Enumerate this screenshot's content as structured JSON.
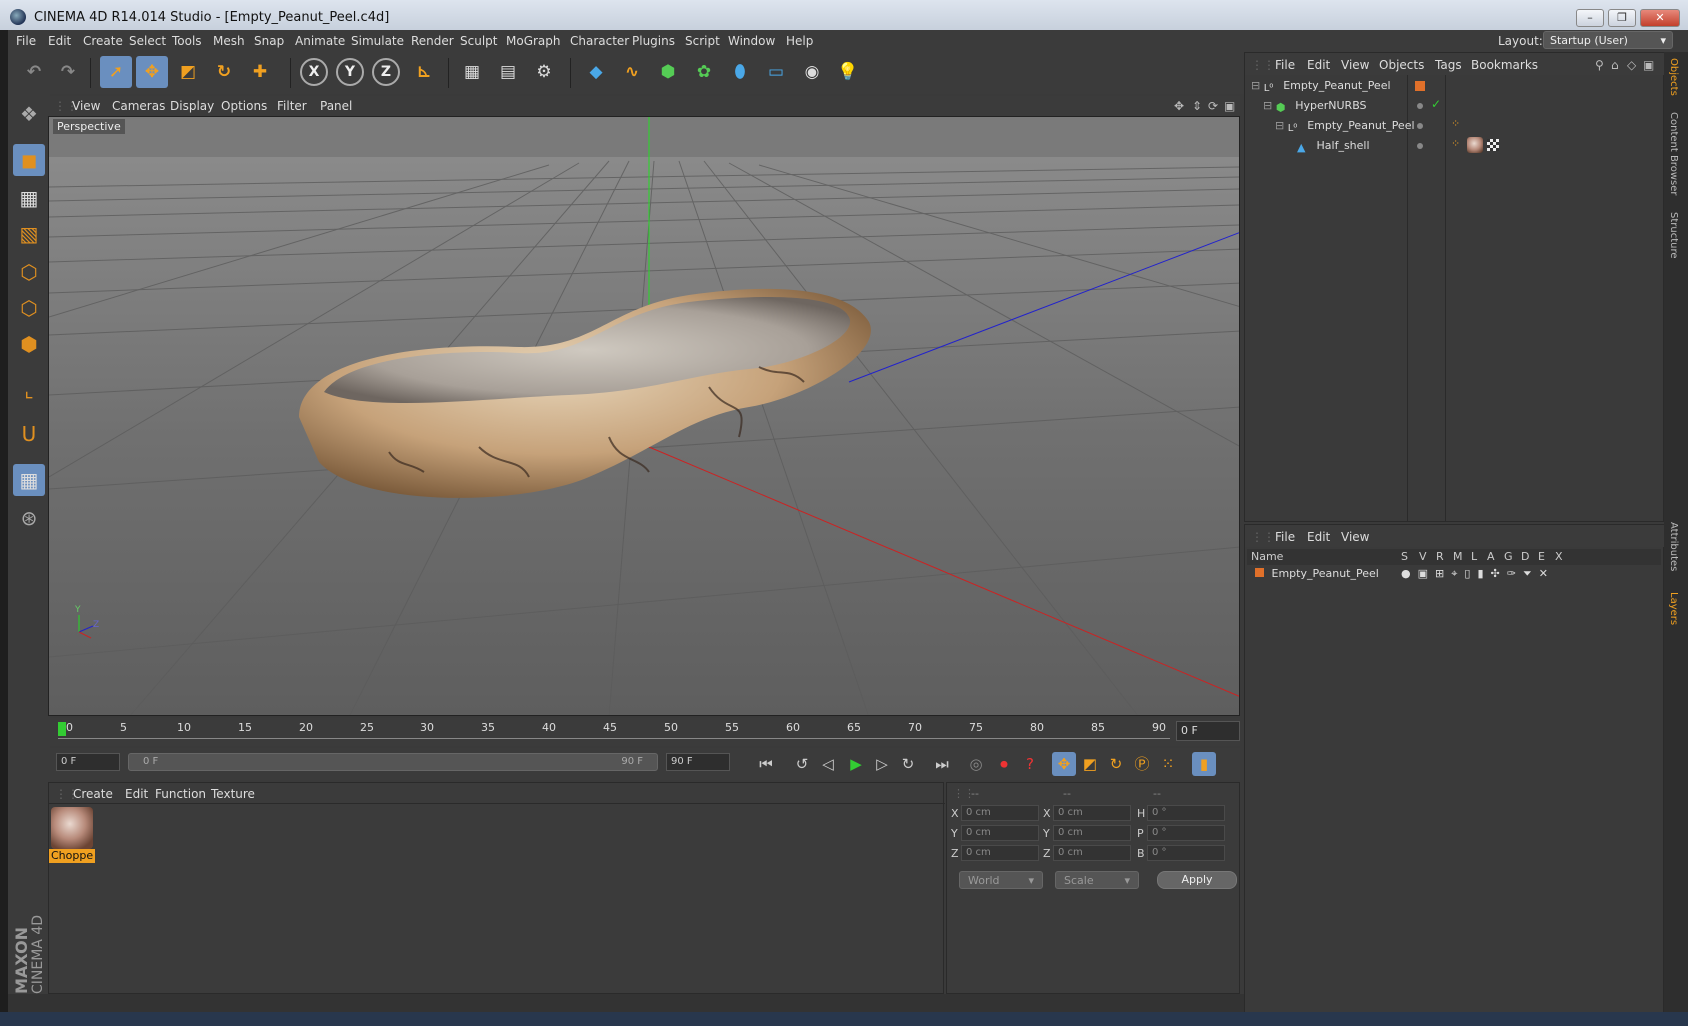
{
  "window": {
    "title": "CINEMA 4D R14.014 Studio - [Empty_Peanut_Peel.c4d]",
    "buttons": [
      "–",
      "❐",
      "✕"
    ]
  },
  "menubar": {
    "items": [
      "File",
      "Edit",
      "Create",
      "Select",
      "Tools",
      "Mesh",
      "Snap",
      "Animate",
      "Simulate",
      "Render",
      "Sculpt",
      "MoGraph",
      "Character",
      "Plugins",
      "Script",
      "Window",
      "Help"
    ],
    "layout_label": "Layout:",
    "layout_value": "Startup (User)"
  },
  "toolbar": {
    "axis_x": "X",
    "axis_y": "Y",
    "axis_z": "Z"
  },
  "viewport": {
    "menu": [
      "View",
      "Cameras",
      "Display",
      "Options",
      "Filter",
      "Panel"
    ],
    "label": "Perspective",
    "axis_y": "Y",
    "axis_z": "Z"
  },
  "timeline": {
    "ticks": [
      "0",
      "5",
      "10",
      "15",
      "20",
      "25",
      "30",
      "35",
      "40",
      "45",
      "50",
      "55",
      "60",
      "65",
      "70",
      "75",
      "80",
      "85",
      "90"
    ],
    "current_frame": "0 F"
  },
  "transport": {
    "start_field": "0 F",
    "range_start": "0 F",
    "range_end": "90 F",
    "end_field": "90 F"
  },
  "materials": {
    "menu": [
      "Create",
      "Edit",
      "Function",
      "Texture"
    ],
    "items": [
      {
        "label": "Choppe"
      }
    ]
  },
  "coords": {
    "headers": [
      "--",
      "--",
      "--"
    ],
    "rows": [
      {
        "a": "X",
        "av": "0 cm",
        "b": "X",
        "bv": "0 cm",
        "c": "H",
        "cv": "0 °"
      },
      {
        "a": "Y",
        "av": "0 cm",
        "b": "Y",
        "bv": "0 cm",
        "c": "P",
        "cv": "0 °"
      },
      {
        "a": "Z",
        "av": "0 cm",
        "b": "Z",
        "bv": "0 cm",
        "c": "B",
        "cv": "0 °"
      }
    ],
    "space": "World",
    "mode": "Scale",
    "apply": "Apply"
  },
  "objects": {
    "menu": [
      "File",
      "Edit",
      "View",
      "Objects",
      "Tags",
      "Bookmarks"
    ],
    "tree": [
      {
        "name": "Empty_Peanut_Peel",
        "depth": 0
      },
      {
        "name": "HyperNURBS",
        "depth": 1
      },
      {
        "name": "Empty_Peanut_Peel",
        "depth": 2
      },
      {
        "name": "Half_shell",
        "depth": 3
      }
    ]
  },
  "layers": {
    "menu": [
      "File",
      "Edit",
      "View"
    ],
    "columns": [
      "Name",
      "S",
      "V",
      "R",
      "M",
      "L",
      "A",
      "G",
      "D",
      "E",
      "X"
    ],
    "rows": [
      {
        "name": "Empty_Peanut_Peel"
      }
    ]
  },
  "side_tabs": [
    "Objects",
    "Content Browser",
    "Structure",
    "Attributes",
    "Layers"
  ],
  "brand": {
    "maxon": "MAXON",
    "product": "CINEMA 4D"
  },
  "colors": {
    "accent": "#f0a020",
    "selection": "#6a8fbf",
    "background": "#3a3a3a"
  }
}
